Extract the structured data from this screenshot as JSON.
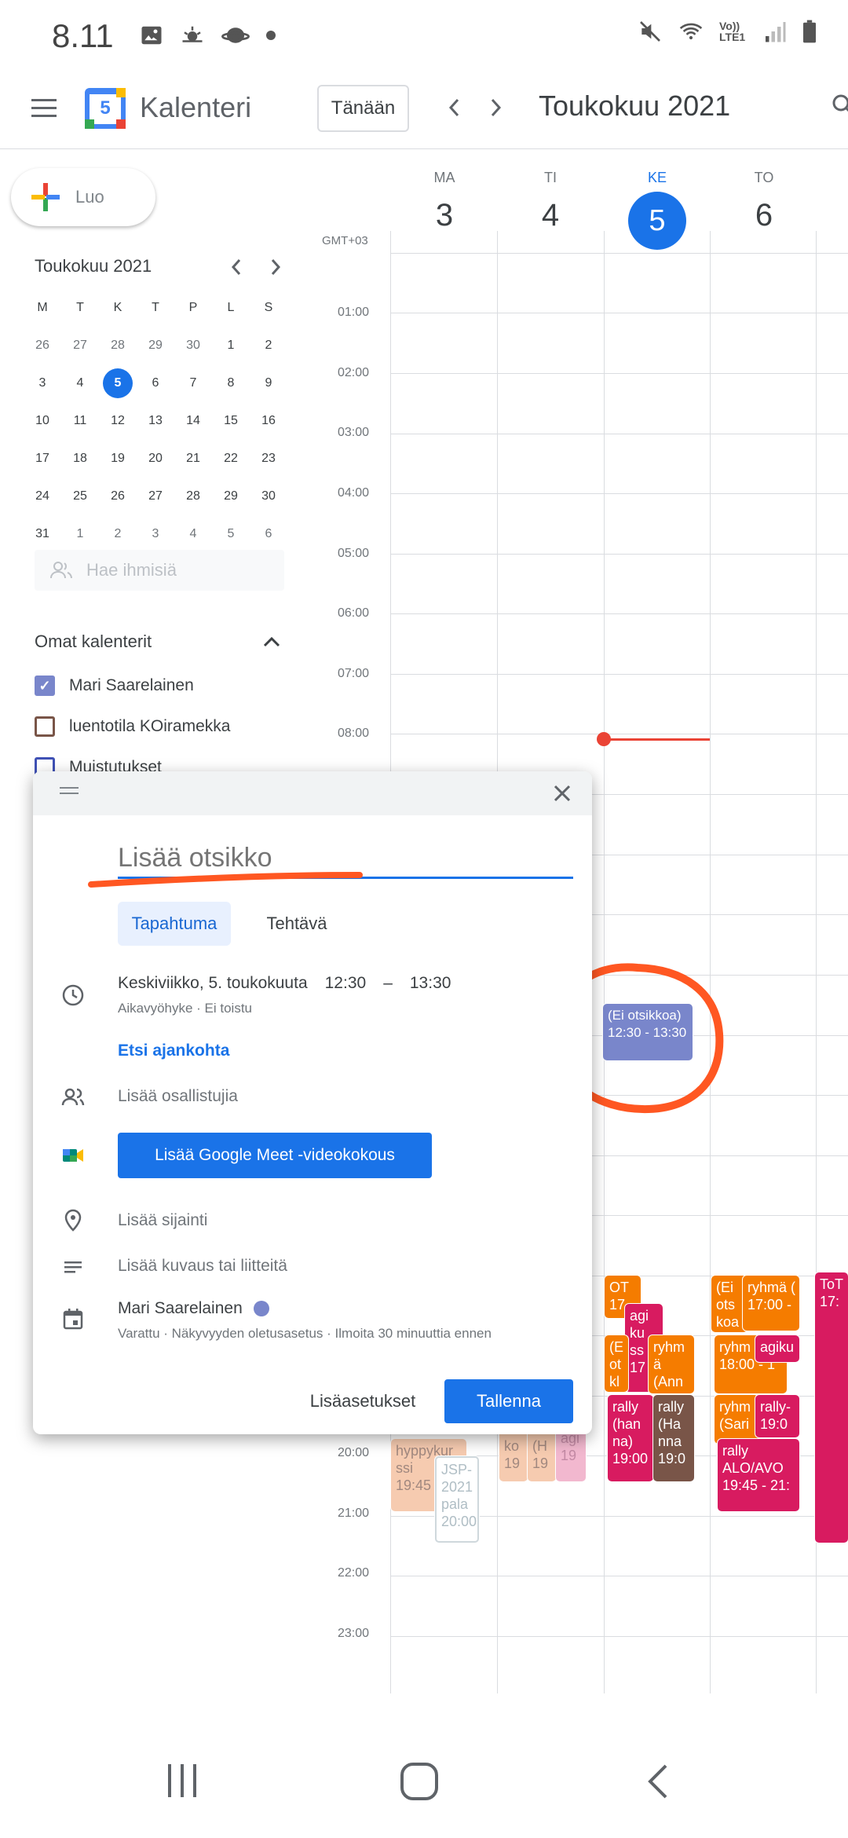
{
  "status_bar": {
    "time": "8.11",
    "network": "Vo)) LTE1"
  },
  "app": {
    "title": "Kalenteri",
    "logo_day": "5",
    "today_button": "Tänään",
    "month_title": "Toukokuu 2021"
  },
  "sidebar": {
    "create_label": "Luo",
    "mini_title": "Toukokuu 2021",
    "weekday_headers": [
      "M",
      "T",
      "K",
      "T",
      "P",
      "L",
      "S"
    ],
    "weeks": [
      [
        "26",
        "27",
        "28",
        "29",
        "30",
        "1",
        "2"
      ],
      [
        "3",
        "4",
        "5",
        "6",
        "7",
        "8",
        "9"
      ],
      [
        "10",
        "11",
        "12",
        "13",
        "14",
        "15",
        "16"
      ],
      [
        "17",
        "18",
        "19",
        "20",
        "21",
        "22",
        "23"
      ],
      [
        "24",
        "25",
        "26",
        "27",
        "28",
        "29",
        "30"
      ],
      [
        "31",
        "1",
        "2",
        "3",
        "4",
        "5",
        "6"
      ]
    ],
    "search_people_placeholder": "Hae ihmisiä",
    "my_calendars_title": "Omat kalenterit",
    "calendars": [
      {
        "label": "Mari Saarelainen",
        "color": "#7986cb",
        "checked": true
      },
      {
        "label": "luentotila KOiramekka",
        "color": "#795548",
        "checked": false
      },
      {
        "label": "Muistutukset",
        "color": "#3f51b5",
        "checked": false
      }
    ]
  },
  "week": {
    "timezone": "GMT+03",
    "days": [
      {
        "name": "MA",
        "num": "3"
      },
      {
        "name": "TI",
        "num": "4"
      },
      {
        "name": "KE",
        "num": "5"
      },
      {
        "name": "TO",
        "num": "6"
      }
    ],
    "hours": [
      "01:00",
      "02:00",
      "03:00",
      "04:00",
      "05:00",
      "06:00",
      "07:00",
      "08:00",
      "20:00",
      "21:00",
      "22:00",
      "23:00"
    ],
    "events": [
      {
        "text": "(Ei otsikkoa)\n12:30 - 13:30",
        "color": "#7986cb"
      },
      {
        "text": "OT\n17",
        "color": "#f57c00"
      },
      {
        "text": "agi\nku\nss\n17",
        "color": "#d81b60"
      },
      {
        "text": "(E\not\nkl",
        "color": "#f57c00"
      },
      {
        "text": "ryhm\nä\n(Ann",
        "color": "#f57c00"
      },
      {
        "text": "rally\n(han\nna)\n19:00",
        "color": "#d81b60"
      },
      {
        "text": "rally\n(Ha\nnna\n19:0",
        "color": "#795548"
      },
      {
        "text": "(Ei\nots\nkoa",
        "color": "#f57c00"
      },
      {
        "text": "ryhmä (\n17:00 -",
        "color": "#f57c00"
      },
      {
        "text": "ryhm\n18:00 - 1",
        "color": "#f57c00"
      },
      {
        "text": "agiku",
        "color": "#d81b60"
      },
      {
        "text": "ryhm\n(Sari",
        "color": "#f57c00"
      },
      {
        "text": "rally-\n19:0",
        "color": "#d81b60"
      },
      {
        "text": "rally\nALO/AVO\n19:45 - 21:",
        "color": "#d81b60"
      },
      {
        "text": "ToT\n17:",
        "color": "#d81b60"
      },
      {
        "text": "hyppykur\nssi\n19:45",
        "color": "#f6cbb0"
      },
      {
        "text": "JSP-\n2021\npala\n20:00",
        "color": "#ffffff"
      },
      {
        "text": "ko\n19",
        "color": "#f6cbb0"
      },
      {
        "text": "(H\n19",
        "color": "#f6cbb0"
      },
      {
        "text": "agi\n19",
        "color": "#f2b8cf"
      }
    ]
  },
  "dialog": {
    "title_placeholder": "Lisää otsikko",
    "tab_event": "Tapahtuma",
    "tab_task": "Tehtävä",
    "date_text": "Keskiviikko, 5. toukokuuta",
    "time_start": "12:30",
    "time_sep": "–",
    "time_end": "13:30",
    "timezone_text": "Aikavyöhyke · Ei toistu",
    "find_time": "Etsi ajankohta",
    "add_guests": "Lisää osallistujia",
    "meet_button": "Lisää Google Meet -videokokous",
    "add_location": "Lisää sijainti",
    "add_description": "Lisää kuvaus tai liitteitä",
    "calendar_owner": "Mari Saarelainen",
    "calendar_details": "Varattu · Näkyvyyden oletusasetus · Ilmoita 30 minuuttia ennen",
    "more_options": "Lisäasetukset",
    "save": "Tallenna"
  },
  "colors": {
    "accent": "#1a73e8",
    "annotation": "#ff5722",
    "now_line": "#ea4335"
  }
}
